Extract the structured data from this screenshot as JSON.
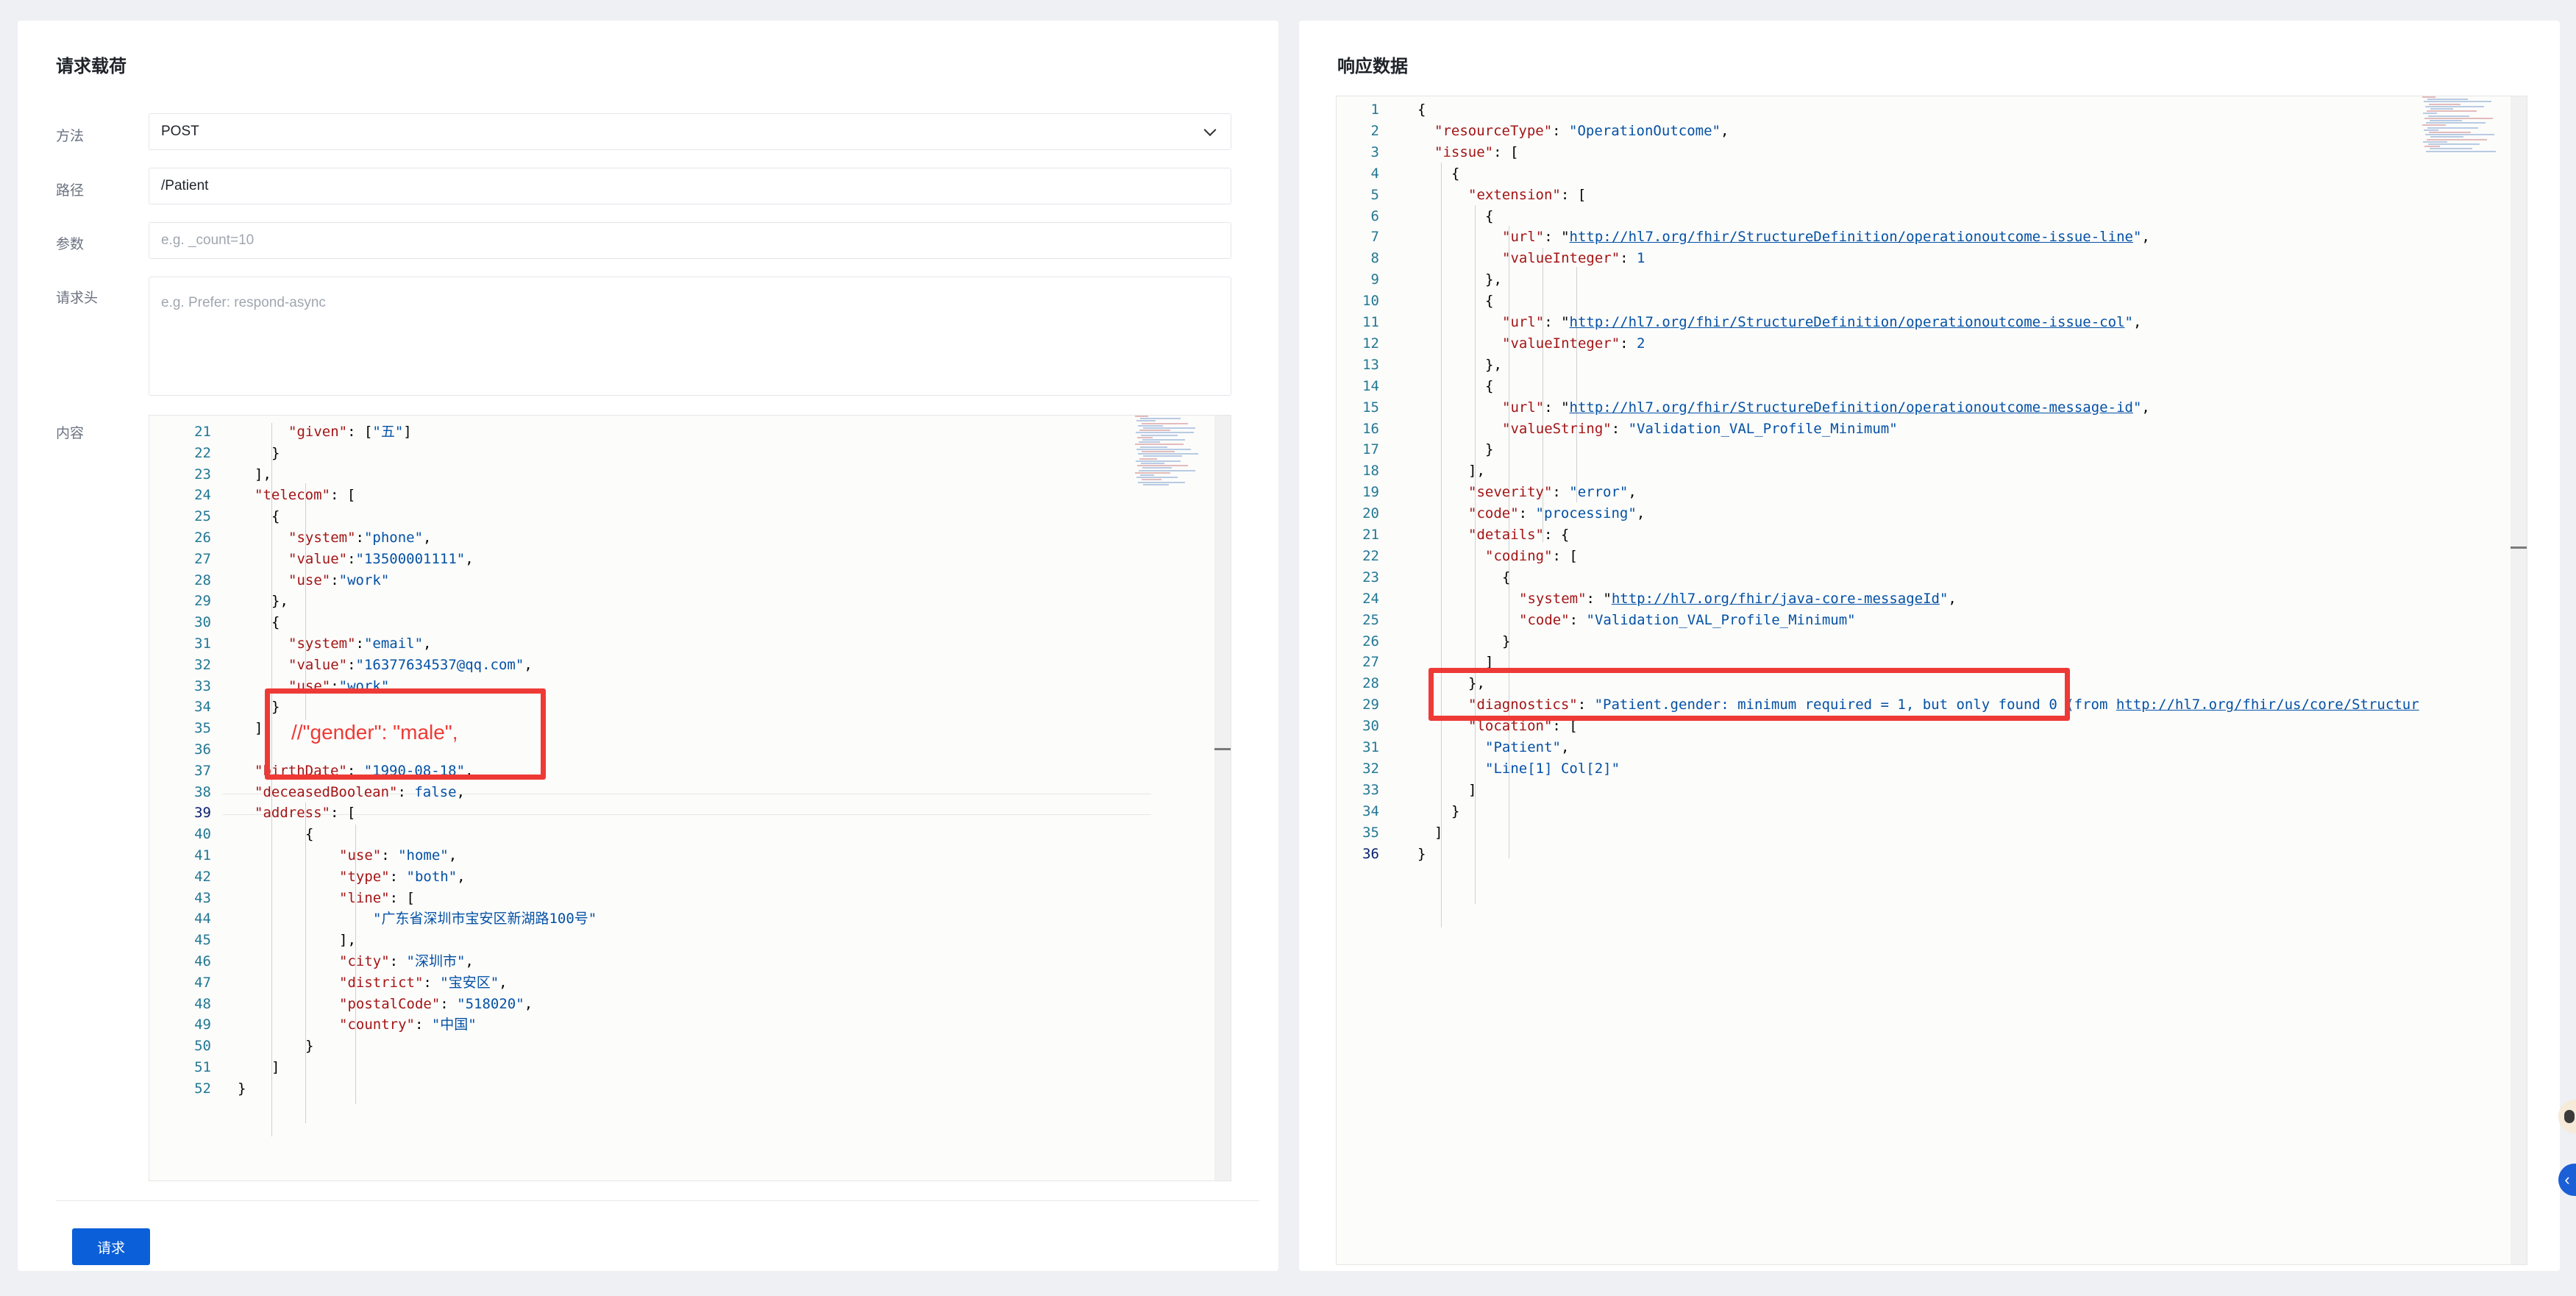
{
  "request_panel": {
    "title": "请求载荷",
    "method_label": "方法",
    "method_value": "POST",
    "path_label": "路径",
    "path_value": "/Patient",
    "params_label": "参数",
    "params_placeholder": "e.g. _count=10",
    "headers_label": "请求头",
    "headers_placeholder": "e.g. Prefer: respond-async",
    "body_label": "内容",
    "submit_label": "请求"
  },
  "response_panel": {
    "title": "响应数据"
  },
  "request_editor": {
    "active_line": 39,
    "lines": [
      {
        "n": 21,
        "indent": 3,
        "tokens": [
          [
            "k",
            "\"given\""
          ],
          [
            "p",
            ": ["
          ],
          [
            "s",
            "\"五\""
          ],
          [
            "p",
            "]"
          ]
        ]
      },
      {
        "n": 22,
        "indent": 2,
        "tokens": [
          [
            "p",
            "}"
          ]
        ]
      },
      {
        "n": 23,
        "indent": 1,
        "tokens": [
          [
            "p",
            "],"
          ]
        ]
      },
      {
        "n": 24,
        "indent": 1,
        "tokens": [
          [
            "k",
            "\"telecom\""
          ],
          [
            "p",
            ": ["
          ]
        ]
      },
      {
        "n": 25,
        "indent": 2,
        "tokens": [
          [
            "p",
            "{"
          ]
        ]
      },
      {
        "n": 26,
        "indent": 3,
        "tokens": [
          [
            "k",
            "\"system\""
          ],
          [
            "p",
            ":"
          ],
          [
            "s",
            "\"phone\""
          ],
          [
            "p",
            ","
          ]
        ]
      },
      {
        "n": 27,
        "indent": 3,
        "tokens": [
          [
            "k",
            "\"value\""
          ],
          [
            "p",
            ":"
          ],
          [
            "s",
            "\"13500001111\""
          ],
          [
            "p",
            ","
          ]
        ]
      },
      {
        "n": 28,
        "indent": 3,
        "tokens": [
          [
            "k",
            "\"use\""
          ],
          [
            "p",
            ":"
          ],
          [
            "s",
            "\"work\""
          ]
        ]
      },
      {
        "n": 29,
        "indent": 2,
        "tokens": [
          [
            "p",
            "},"
          ]
        ]
      },
      {
        "n": 30,
        "indent": 2,
        "tokens": [
          [
            "p",
            "{"
          ]
        ]
      },
      {
        "n": 31,
        "indent": 3,
        "tokens": [
          [
            "k",
            "\"system\""
          ],
          [
            "p",
            ":"
          ],
          [
            "s",
            "\"email\""
          ],
          [
            "p",
            ","
          ]
        ]
      },
      {
        "n": 32,
        "indent": 3,
        "tokens": [
          [
            "k",
            "\"value\""
          ],
          [
            "p",
            ":"
          ],
          [
            "s",
            "\"16377634537@qq.com\""
          ],
          [
            "p",
            ","
          ]
        ]
      },
      {
        "n": 33,
        "indent": 3,
        "tokens": [
          [
            "k",
            "\"use\""
          ],
          [
            "p",
            ":"
          ],
          [
            "s",
            "\"work\""
          ]
        ]
      },
      {
        "n": 34,
        "indent": 2,
        "tokens": [
          [
            "p",
            "}"
          ]
        ]
      },
      {
        "n": 35,
        "indent": 1,
        "tokens": [
          [
            "p",
            "],"
          ]
        ]
      },
      {
        "n": 36,
        "indent": 1,
        "tokens": []
      },
      {
        "n": 37,
        "indent": 1,
        "tokens": [
          [
            "k",
            "\"birthDate\""
          ],
          [
            "p",
            ": "
          ],
          [
            "s",
            "\"1990-08-18\""
          ],
          [
            "p",
            ","
          ]
        ]
      },
      {
        "n": 38,
        "indent": 1,
        "tokens": [
          [
            "k",
            "\"deceasedBoolean\""
          ],
          [
            "p",
            ": "
          ],
          [
            "lit",
            "false"
          ],
          [
            "p",
            ","
          ]
        ]
      },
      {
        "n": 39,
        "indent": 1,
        "tokens": [
          [
            "k",
            "\"address\""
          ],
          [
            "p",
            ": ["
          ]
        ]
      },
      {
        "n": 40,
        "indent": 4,
        "tokens": [
          [
            "p",
            "{"
          ]
        ]
      },
      {
        "n": 41,
        "indent": 6,
        "tokens": [
          [
            "k",
            "\"use\""
          ],
          [
            "p",
            ": "
          ],
          [
            "s",
            "\"home\""
          ],
          [
            "p",
            ","
          ]
        ]
      },
      {
        "n": 42,
        "indent": 6,
        "tokens": [
          [
            "k",
            "\"type\""
          ],
          [
            "p",
            ": "
          ],
          [
            "s",
            "\"both\""
          ],
          [
            "p",
            ","
          ]
        ]
      },
      {
        "n": 43,
        "indent": 6,
        "tokens": [
          [
            "k",
            "\"line\""
          ],
          [
            "p",
            ": ["
          ]
        ]
      },
      {
        "n": 44,
        "indent": 8,
        "tokens": [
          [
            "s",
            "\"广东省深圳市宝安区新湖路100号\""
          ]
        ]
      },
      {
        "n": 45,
        "indent": 6,
        "tokens": [
          [
            "p",
            "],"
          ]
        ]
      },
      {
        "n": 46,
        "indent": 6,
        "tokens": [
          [
            "k",
            "\"city\""
          ],
          [
            "p",
            ": "
          ],
          [
            "s",
            "\"深圳市\""
          ],
          [
            "p",
            ","
          ]
        ]
      },
      {
        "n": 47,
        "indent": 6,
        "tokens": [
          [
            "k",
            "\"district\""
          ],
          [
            "p",
            ": "
          ],
          [
            "s",
            "\"宝安区\""
          ],
          [
            "p",
            ","
          ]
        ]
      },
      {
        "n": 48,
        "indent": 6,
        "tokens": [
          [
            "k",
            "\"postalCode\""
          ],
          [
            "p",
            ": "
          ],
          [
            "s",
            "\"518020\""
          ],
          [
            "p",
            ","
          ]
        ]
      },
      {
        "n": 49,
        "indent": 6,
        "tokens": [
          [
            "k",
            "\"country\""
          ],
          [
            "p",
            ": "
          ],
          [
            "s",
            "\"中国\""
          ]
        ]
      },
      {
        "n": 50,
        "indent": 4,
        "tokens": [
          [
            "p",
            "}"
          ]
        ]
      },
      {
        "n": 51,
        "indent": 2,
        "tokens": [
          [
            "p",
            "]"
          ]
        ]
      },
      {
        "n": 52,
        "indent": 0,
        "tokens": [
          [
            "p",
            "}"
          ]
        ]
      }
    ]
  },
  "annotation": {
    "text": "//\"gender\": \"male\","
  },
  "response_editor": {
    "active_line": 36,
    "lines": [
      {
        "n": 1,
        "indent": 0,
        "tokens": [
          [
            "p",
            "{"
          ]
        ]
      },
      {
        "n": 2,
        "indent": 1,
        "tokens": [
          [
            "k",
            "\"resourceType\""
          ],
          [
            "p",
            ": "
          ],
          [
            "s",
            "\"OperationOutcome\""
          ],
          [
            "p",
            ","
          ]
        ]
      },
      {
        "n": 3,
        "indent": 1,
        "tokens": [
          [
            "k",
            "\"issue\""
          ],
          [
            "p",
            ": ["
          ]
        ]
      },
      {
        "n": 4,
        "indent": 2,
        "tokens": [
          [
            "p",
            "{"
          ]
        ]
      },
      {
        "n": 5,
        "indent": 3,
        "tokens": [
          [
            "k",
            "\"extension\""
          ],
          [
            "p",
            ": ["
          ]
        ]
      },
      {
        "n": 6,
        "indent": 4,
        "tokens": [
          [
            "p",
            "{"
          ]
        ]
      },
      {
        "n": 7,
        "indent": 5,
        "tokens": [
          [
            "k",
            "\"url\""
          ],
          [
            "p",
            ": \""
          ],
          [
            "link",
            "http://hl7.org/fhir/StructureDefinition/operationoutcome-issue-line"
          ],
          [
            "s",
            "\""
          ],
          [
            "p",
            ","
          ]
        ]
      },
      {
        "n": 8,
        "indent": 5,
        "tokens": [
          [
            "k",
            "\"valueInteger\""
          ],
          [
            "p",
            ": "
          ],
          [
            "lit",
            "1"
          ]
        ]
      },
      {
        "n": 9,
        "indent": 4,
        "tokens": [
          [
            "p",
            "},"
          ]
        ]
      },
      {
        "n": 10,
        "indent": 4,
        "tokens": [
          [
            "p",
            "{"
          ]
        ]
      },
      {
        "n": 11,
        "indent": 5,
        "tokens": [
          [
            "k",
            "\"url\""
          ],
          [
            "p",
            ": \""
          ],
          [
            "link",
            "http://hl7.org/fhir/StructureDefinition/operationoutcome-issue-col"
          ],
          [
            "s",
            "\""
          ],
          [
            "p",
            ","
          ]
        ]
      },
      {
        "n": 12,
        "indent": 5,
        "tokens": [
          [
            "k",
            "\"valueInteger\""
          ],
          [
            "p",
            ": "
          ],
          [
            "lit",
            "2"
          ]
        ]
      },
      {
        "n": 13,
        "indent": 4,
        "tokens": [
          [
            "p",
            "},"
          ]
        ]
      },
      {
        "n": 14,
        "indent": 4,
        "tokens": [
          [
            "p",
            "{"
          ]
        ]
      },
      {
        "n": 15,
        "indent": 5,
        "tokens": [
          [
            "k",
            "\"url\""
          ],
          [
            "p",
            ": \""
          ],
          [
            "link",
            "http://hl7.org/fhir/StructureDefinition/operationoutcome-message-id"
          ],
          [
            "s",
            "\""
          ],
          [
            "p",
            ","
          ]
        ]
      },
      {
        "n": 16,
        "indent": 5,
        "tokens": [
          [
            "k",
            "\"valueString\""
          ],
          [
            "p",
            ": "
          ],
          [
            "s",
            "\"Validation_VAL_Profile_Minimum\""
          ]
        ]
      },
      {
        "n": 17,
        "indent": 4,
        "tokens": [
          [
            "p",
            "}"
          ]
        ]
      },
      {
        "n": 18,
        "indent": 3,
        "tokens": [
          [
            "p",
            "],"
          ]
        ]
      },
      {
        "n": 19,
        "indent": 3,
        "tokens": [
          [
            "k",
            "\"severity\""
          ],
          [
            "p",
            ": "
          ],
          [
            "s",
            "\"error\""
          ],
          [
            "p",
            ","
          ]
        ]
      },
      {
        "n": 20,
        "indent": 3,
        "tokens": [
          [
            "k",
            "\"code\""
          ],
          [
            "p",
            ": "
          ],
          [
            "s",
            "\"processing\""
          ],
          [
            "p",
            ","
          ]
        ]
      },
      {
        "n": 21,
        "indent": 3,
        "tokens": [
          [
            "k",
            "\"details\""
          ],
          [
            "p",
            ": {"
          ]
        ]
      },
      {
        "n": 22,
        "indent": 4,
        "tokens": [
          [
            "k",
            "\"coding\""
          ],
          [
            "p",
            ": ["
          ]
        ]
      },
      {
        "n": 23,
        "indent": 5,
        "tokens": [
          [
            "p",
            "{"
          ]
        ]
      },
      {
        "n": 24,
        "indent": 6,
        "tokens": [
          [
            "k",
            "\"system\""
          ],
          [
            "p",
            ": \""
          ],
          [
            "link",
            "http://hl7.org/fhir/java-core-messageId"
          ],
          [
            "s",
            "\""
          ],
          [
            "p",
            ","
          ]
        ]
      },
      {
        "n": 25,
        "indent": 6,
        "tokens": [
          [
            "k",
            "\"code\""
          ],
          [
            "p",
            ": "
          ],
          [
            "s",
            "\"Validation_VAL_Profile_Minimum\""
          ]
        ]
      },
      {
        "n": 26,
        "indent": 5,
        "tokens": [
          [
            "p",
            "}"
          ]
        ]
      },
      {
        "n": 27,
        "indent": 4,
        "tokens": [
          [
            "p",
            "]"
          ]
        ]
      },
      {
        "n": 28,
        "indent": 3,
        "tokens": [
          [
            "p",
            "},"
          ]
        ]
      },
      {
        "n": 29,
        "indent": 3,
        "tokens": [
          [
            "k",
            "\"diagnostics\""
          ],
          [
            "p",
            ": "
          ],
          [
            "s",
            "\"Patient.gender: minimum required = 1, but only found 0 (from "
          ],
          [
            "link",
            "http://hl7.org/fhir/us/core/Structur"
          ]
        ]
      },
      {
        "n": 30,
        "indent": 3,
        "tokens": [
          [
            "k",
            "\"location\""
          ],
          [
            "p",
            ": ["
          ]
        ]
      },
      {
        "n": 31,
        "indent": 4,
        "tokens": [
          [
            "s",
            "\"Patient\""
          ],
          [
            "p",
            ","
          ]
        ]
      },
      {
        "n": 32,
        "indent": 4,
        "tokens": [
          [
            "s",
            "\"Line[1] Col[2]\""
          ]
        ]
      },
      {
        "n": 33,
        "indent": 3,
        "tokens": [
          [
            "p",
            "]"
          ]
        ]
      },
      {
        "n": 34,
        "indent": 2,
        "tokens": [
          [
            "p",
            "}"
          ]
        ]
      },
      {
        "n": 35,
        "indent": 1,
        "tokens": [
          [
            "p",
            "]"
          ]
        ]
      },
      {
        "n": 36,
        "indent": 0,
        "tokens": [
          [
            "p",
            "}"
          ]
        ]
      }
    ]
  }
}
